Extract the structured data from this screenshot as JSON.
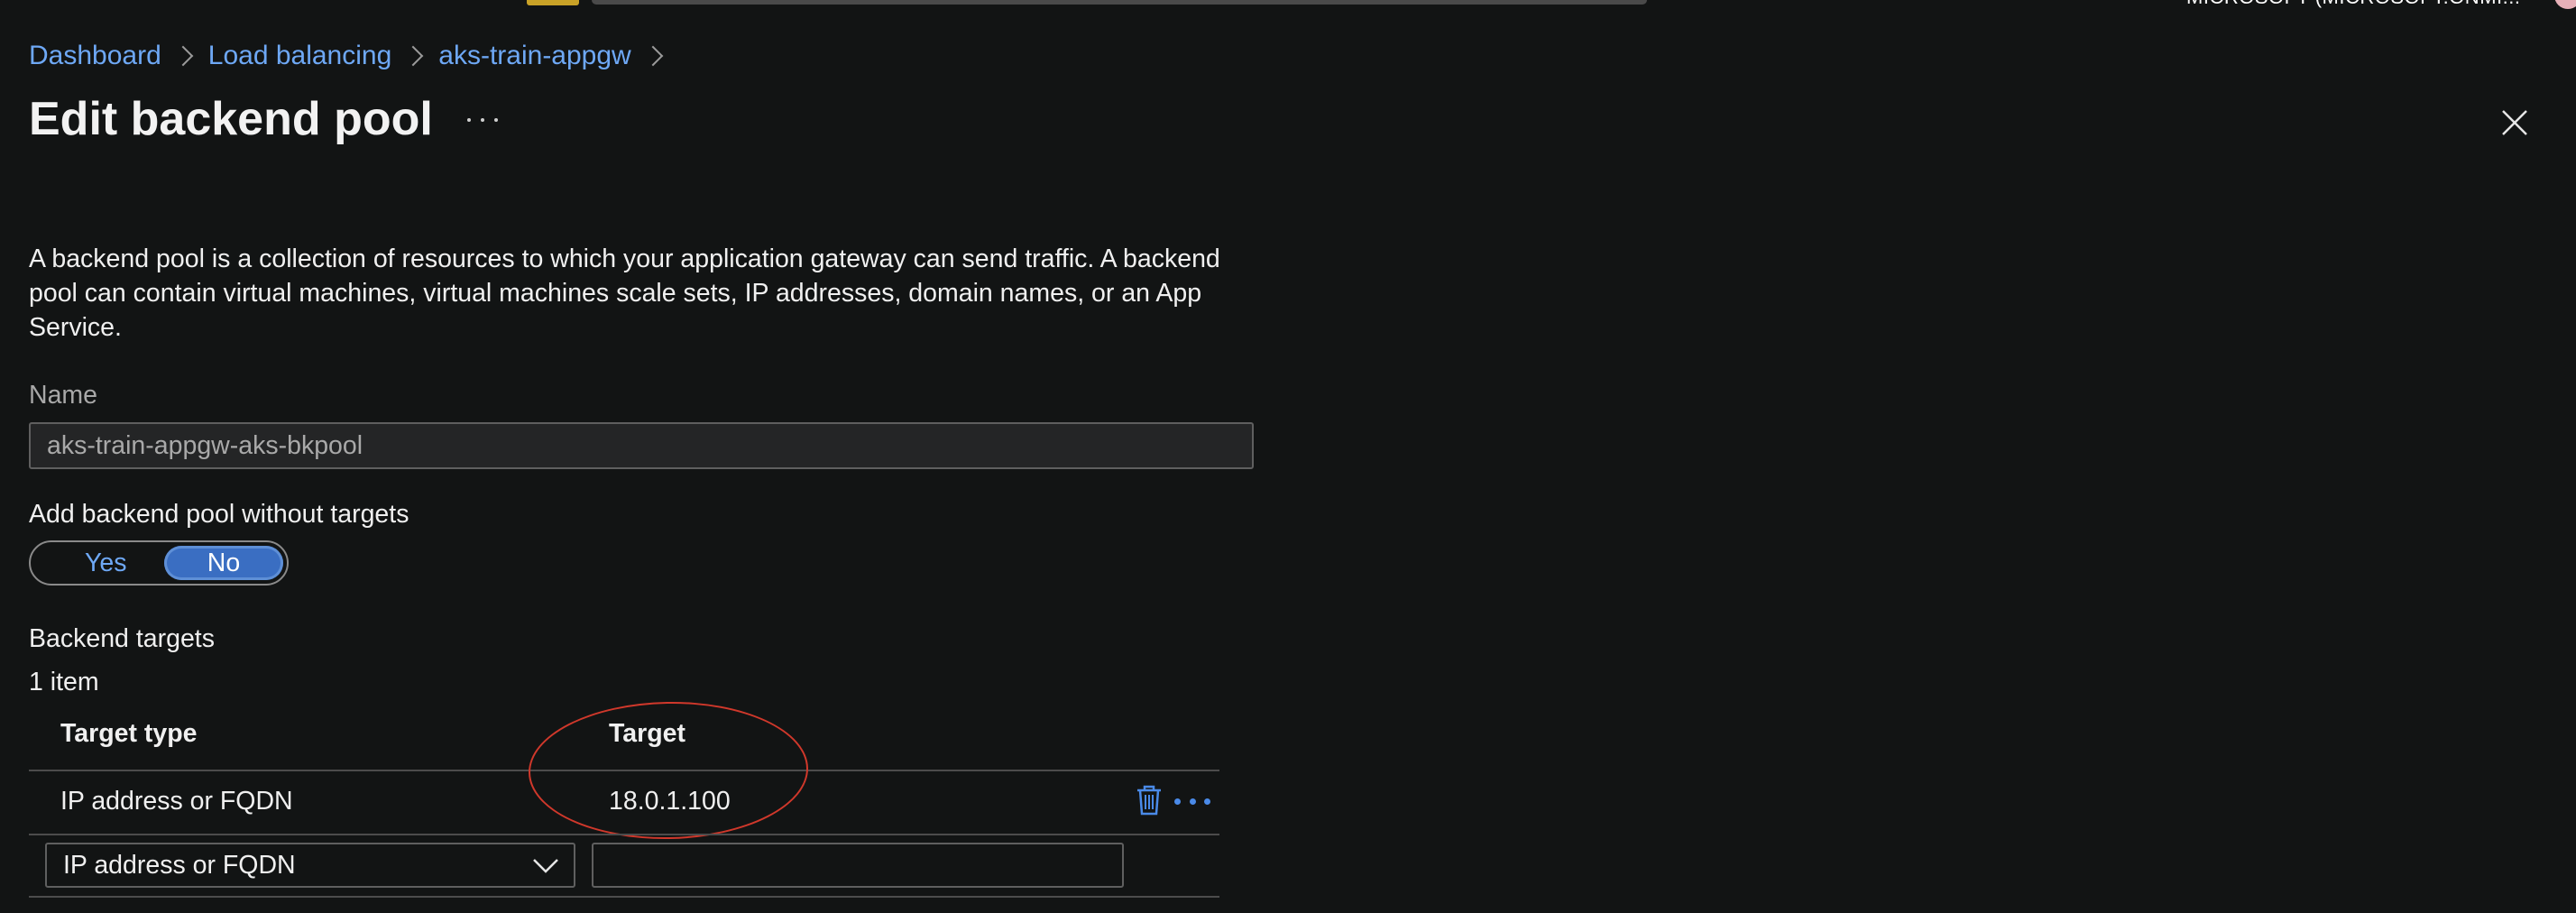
{
  "topbar": {
    "account": "MICROSOFT (MICROSOFT.ONMI..."
  },
  "breadcrumb": {
    "items": [
      "Dashboard",
      "Load balancing",
      "aks-train-appgw"
    ]
  },
  "page": {
    "title": "Edit backend pool",
    "description": "A backend pool is a collection of resources to which your application gateway can send traffic. A backend pool can contain virtual machines, virtual machines scale sets, IP addresses, domain names, or an App Service."
  },
  "form": {
    "name_label": "Name",
    "name_value": "aks-train-appgw-aks-bkpool",
    "without_targets_label": "Add backend pool without targets",
    "toggle": {
      "yes": "Yes",
      "no": "No",
      "selected": "No"
    }
  },
  "targets": {
    "section_title": "Backend targets",
    "count_text": "1 item",
    "columns": [
      "Target type",
      "Target"
    ],
    "rows": [
      {
        "type": "IP address or FQDN",
        "target": "18.0.1.100"
      }
    ],
    "new_row": {
      "type_value": "IP address or FQDN",
      "target_value": ""
    }
  },
  "icons": {
    "close": "close-icon",
    "more": "more-horizontal-icon",
    "delete": "trash-icon",
    "chevron": "chevron-down-icon"
  },
  "colors": {
    "link": "#6ea8f5",
    "accent": "#3a6ec2",
    "annotation": "#d0382b",
    "background": "#121414"
  }
}
